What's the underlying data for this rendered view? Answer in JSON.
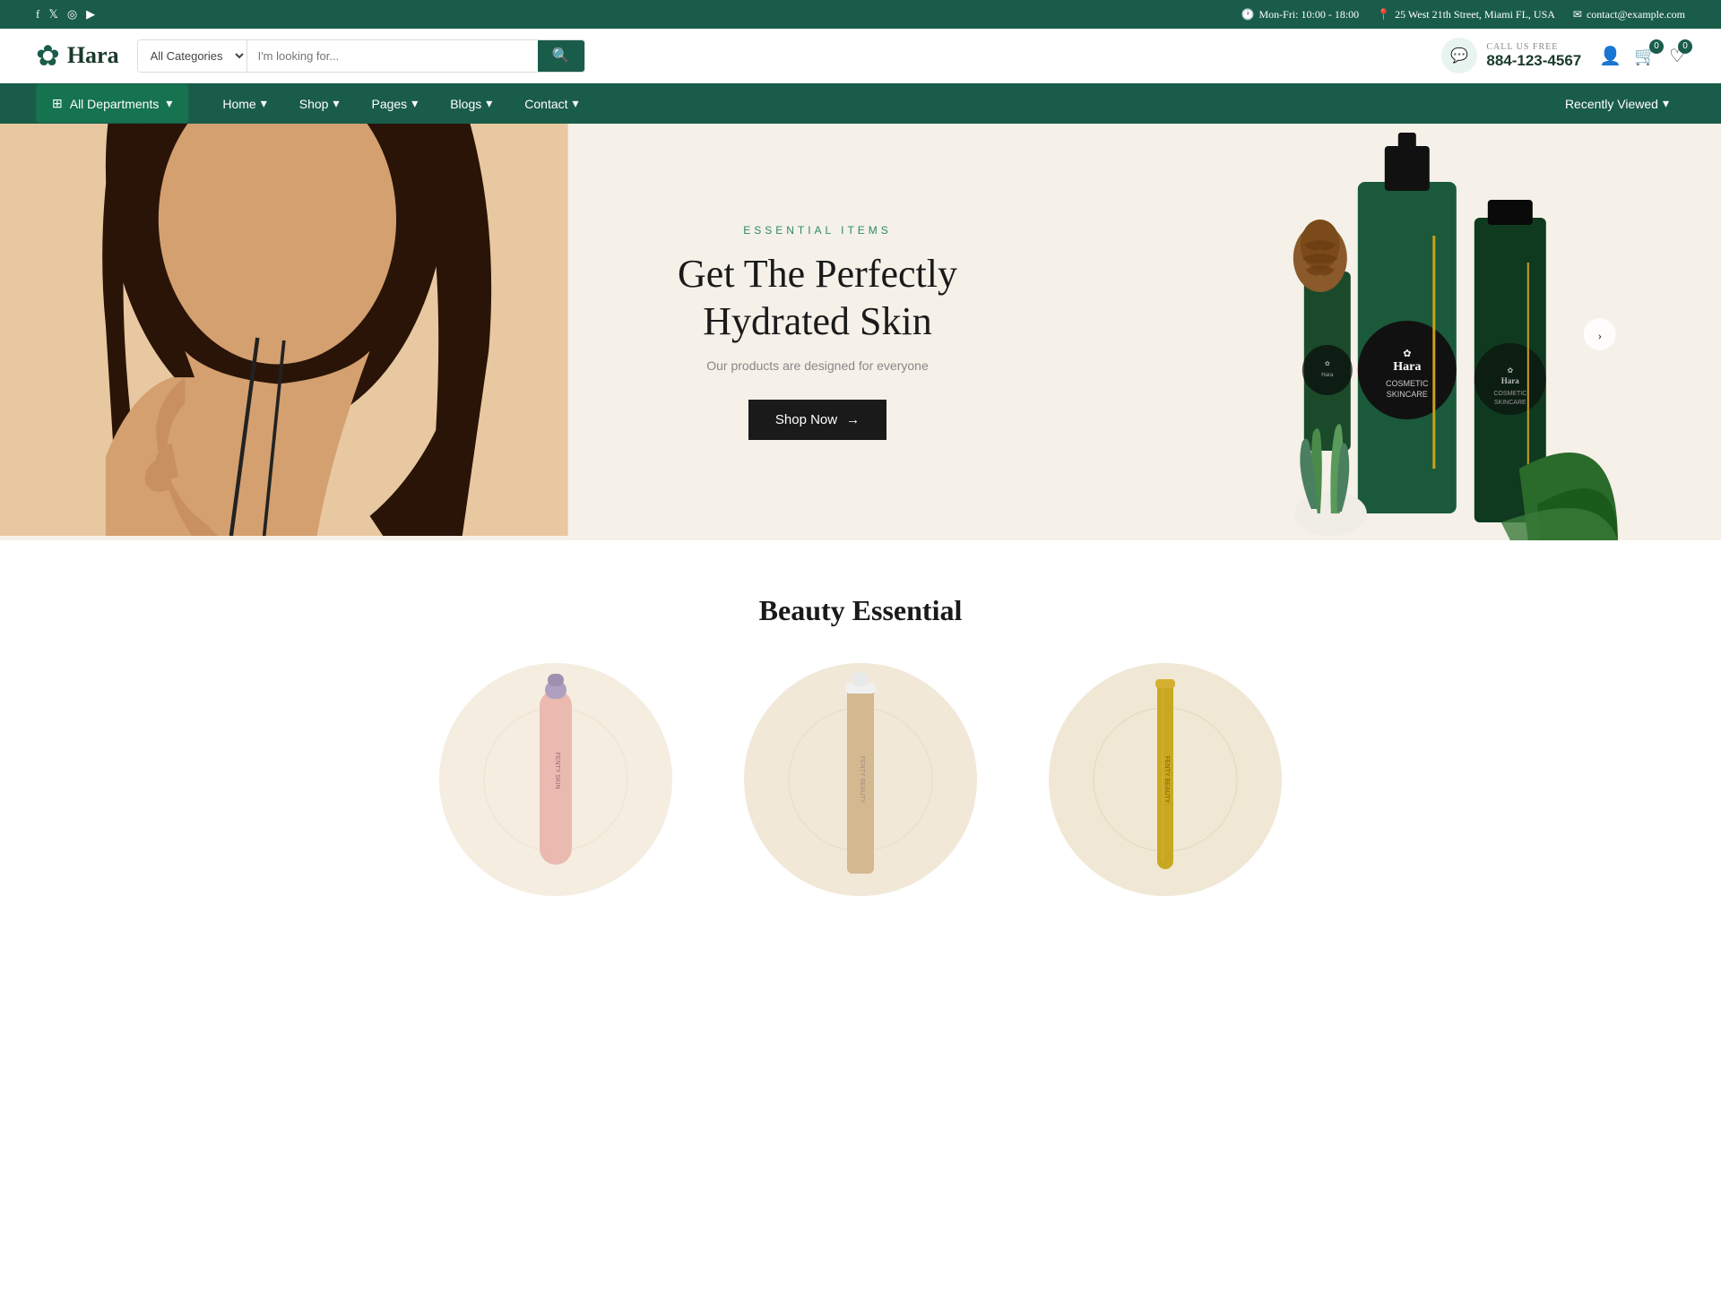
{
  "topbar": {
    "hours": "Mon-Fri: 10:00 - 18:00",
    "address": "25 West 21th Street, Miami FL, USA",
    "email": "contact@example.com",
    "social": [
      "f",
      "t",
      "in",
      "yt"
    ]
  },
  "header": {
    "logo_text": "Hara",
    "search_placeholder": "I'm looking for...",
    "search_category": "All Categories",
    "phone_label": "CALL US FREE",
    "phone_number": "884-123-4567",
    "cart_count": "0",
    "wishlist_count": "0"
  },
  "nav": {
    "departments_label": "All Departments",
    "links": [
      {
        "label": "Home",
        "has_dropdown": true
      },
      {
        "label": "Shop",
        "has_dropdown": true
      },
      {
        "label": "Pages",
        "has_dropdown": true
      },
      {
        "label": "Blogs",
        "has_dropdown": true
      },
      {
        "label": "Contact",
        "has_dropdown": true
      }
    ],
    "recently_viewed_label": "Recently Viewed"
  },
  "hero": {
    "tagline": "ESSENTIAL ITEMS",
    "title_line1": "Get The Perfectly",
    "title_line2": "Hydrated Skin",
    "subtitle": "Our products are designed for everyone",
    "cta_label": "Shop Now"
  },
  "beauty_section": {
    "title": "Beauty Essential",
    "products": [
      {
        "id": 1,
        "color": "#f5ede0",
        "bottle_type": "pink"
      },
      {
        "id": 2,
        "color": "#f2e8d8",
        "bottle_type": "beige"
      },
      {
        "id": 3,
        "color": "#f0e8d5",
        "bottle_type": "gold"
      }
    ]
  },
  "icons": {
    "facebook": "f",
    "twitter": "𝕏",
    "instagram": "◎",
    "youtube": "▶",
    "search": "🔍",
    "phone": "📞",
    "user": "👤",
    "cart": "🛒",
    "heart": "♡",
    "clock": "🕐",
    "location": "📍",
    "mail": "✉",
    "chevron": "▾",
    "arrow_right": "→",
    "grid": "⊞",
    "chat": "💬"
  },
  "colors": {
    "primary_green": "#1a5c4a",
    "dark_green": "#15734f",
    "light_bg": "#f5f0e8",
    "accent_teal": "#2a8a6a",
    "dark": "#1a1a1a"
  }
}
